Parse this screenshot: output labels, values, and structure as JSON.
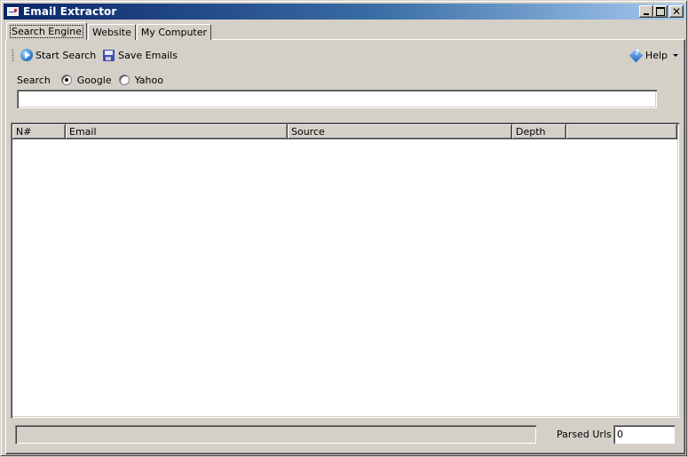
{
  "window": {
    "title": "Email Extractor",
    "controls": {
      "minimize": "minimize",
      "maximize": "maximize",
      "close": "✕"
    }
  },
  "tabs": [
    {
      "label": "Search Engine",
      "active": true
    },
    {
      "label": "Website",
      "active": false
    },
    {
      "label": "My Computer",
      "active": false
    }
  ],
  "toolbar": {
    "start_search": "Start Search",
    "save_emails": "Save Emails",
    "help": "Help"
  },
  "search": {
    "label": "Search",
    "engines": [
      {
        "label": "Google",
        "checked": true
      },
      {
        "label": "Yahoo",
        "checked": false
      }
    ],
    "query_value": "",
    "query_placeholder": ""
  },
  "results": {
    "columns": [
      "N#",
      "Email",
      "Source",
      "Depth",
      ""
    ],
    "rows": []
  },
  "status": {
    "progress": 0,
    "parsed_urls_label": "Parsed Urls",
    "parsed_urls_value": "0"
  }
}
